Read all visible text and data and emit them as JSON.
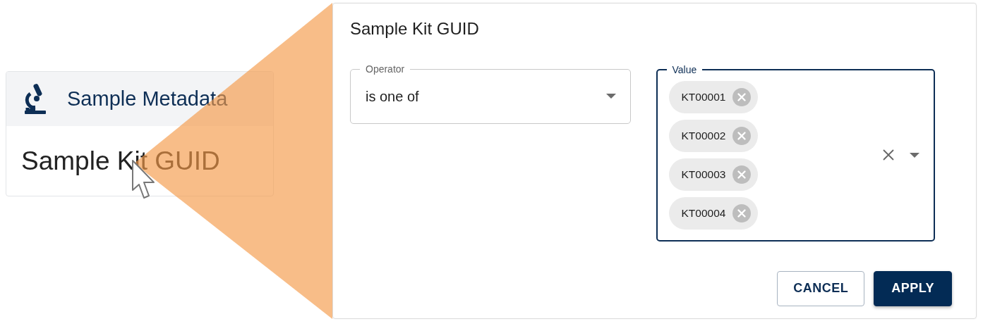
{
  "menu_card": {
    "section": {
      "title": "Sample Metadata"
    },
    "item": "Sample Kit GUID"
  },
  "dialog": {
    "title": "Sample Kit GUID",
    "operator": {
      "label": "Operator",
      "value": "is one of"
    },
    "value_field": {
      "label": "Value",
      "focused": true,
      "chips": [
        {
          "label": "KT00001"
        },
        {
          "label": "KT00002"
        },
        {
          "label": "KT00003"
        },
        {
          "label": "KT00004"
        }
      ]
    },
    "buttons": [
      {
        "label": "CANCEL",
        "kind": "outlined"
      },
      {
        "label": "APPLY",
        "kind": "contained"
      }
    ]
  }
}
